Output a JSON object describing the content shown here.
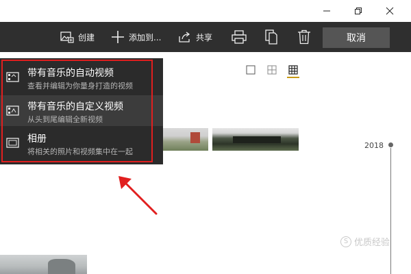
{
  "toolbar": {
    "create_label": "创建",
    "addto_label": "添加到...",
    "share_label": "共享",
    "cancel_label": "取消"
  },
  "menu": {
    "items": [
      {
        "title": "带有音乐的自动视频",
        "subtitle": "查看并编辑为你量身打造的视频"
      },
      {
        "title": "带有音乐的自定义视频",
        "subtitle": "从头到尾编辑全新视频"
      },
      {
        "title": "相册",
        "subtitle": "将相关的照片和视频集中在一起"
      }
    ]
  },
  "timeline": {
    "year": "2018"
  },
  "watermark": {
    "mark": "S",
    "text": "优质经验"
  },
  "colors": {
    "toolbar_bg": "#2f2f2f",
    "menu_bg": "#2b2b2b",
    "menu_hover": "#3c3c3c",
    "highlight_red": "#e11f1f",
    "view_accent": "#c89a14",
    "cancel_bg": "#555555"
  }
}
